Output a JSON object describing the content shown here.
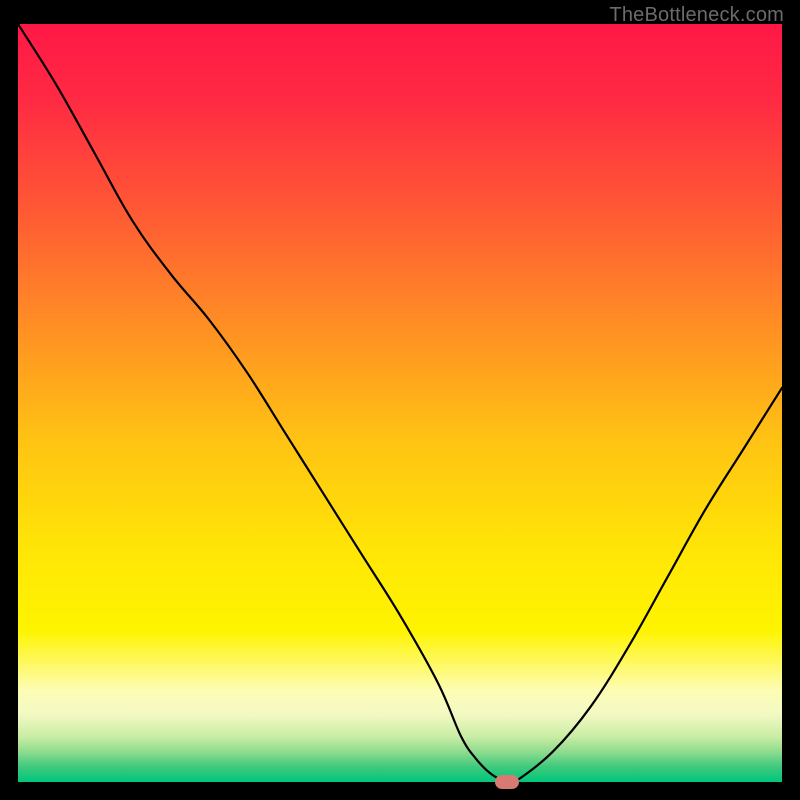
{
  "watermark": "TheBottleneck.com",
  "chart_data": {
    "type": "line",
    "title": "",
    "xlabel": "",
    "ylabel": "",
    "xlim": [
      0,
      100
    ],
    "ylim": [
      0,
      100
    ],
    "x": [
      0,
      5,
      10,
      15,
      20,
      25,
      30,
      35,
      40,
      45,
      50,
      55,
      58,
      60,
      62,
      64,
      65,
      70,
      75,
      80,
      85,
      90,
      95,
      100
    ],
    "values": [
      100,
      92,
      83,
      74,
      67,
      61,
      54,
      46,
      38,
      30,
      22,
      13,
      6,
      3,
      1,
      0,
      0,
      4,
      10,
      18,
      27,
      36,
      44,
      52
    ],
    "marker": {
      "x": 64,
      "y": 0
    },
    "background_gradient": {
      "stops": [
        {
          "pos": 0.0,
          "color": "#ff1846"
        },
        {
          "pos": 0.1,
          "color": "#ff2a43"
        },
        {
          "pos": 0.25,
          "color": "#ff5a34"
        },
        {
          "pos": 0.4,
          "color": "#ff8f24"
        },
        {
          "pos": 0.55,
          "color": "#ffc313"
        },
        {
          "pos": 0.7,
          "color": "#ffe706"
        },
        {
          "pos": 0.8,
          "color": "#fff400"
        },
        {
          "pos": 0.88,
          "color": "#fdfdb6"
        },
        {
          "pos": 0.91,
          "color": "#f4f9c4"
        },
        {
          "pos": 0.94,
          "color": "#c9eda4"
        },
        {
          "pos": 0.96,
          "color": "#8fdc8e"
        },
        {
          "pos": 0.98,
          "color": "#3fc97d"
        },
        {
          "pos": 1.0,
          "color": "#00c87a"
        }
      ]
    }
  },
  "colors": {
    "curve": "#000000",
    "marker": "#d77a73"
  }
}
